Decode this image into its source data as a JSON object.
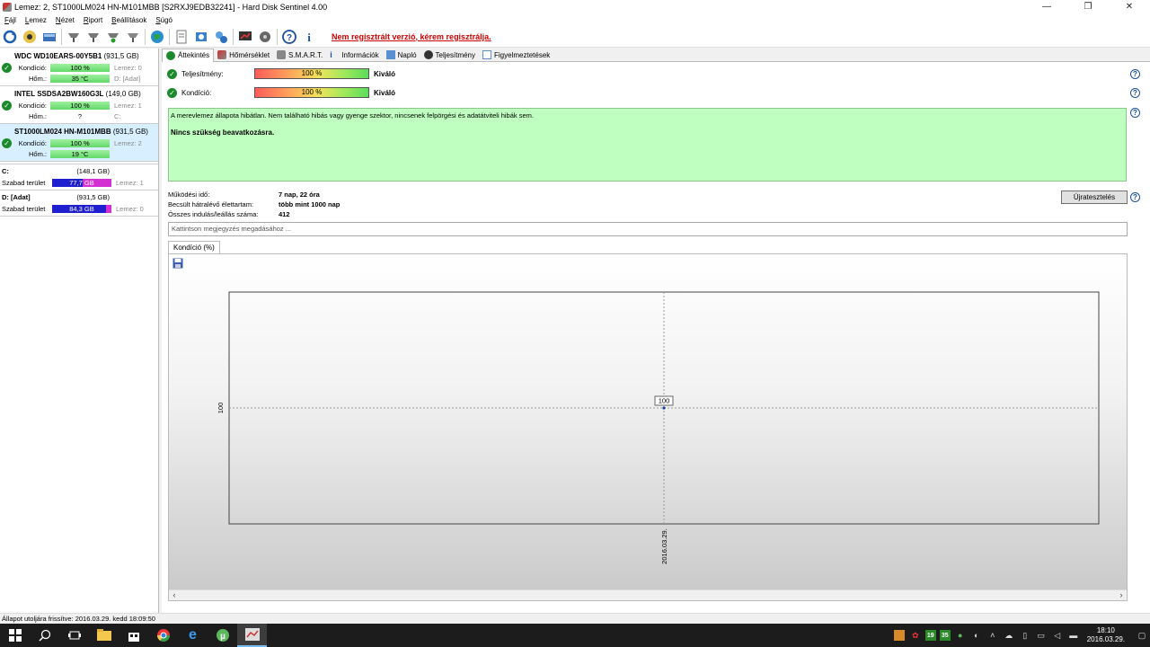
{
  "window": {
    "title": "Lemez: 2, ST1000LM024 HN-M101MBB [S2RXJ9EDB32241]  -  Hard Disk Sentinel 4.00",
    "controls": [
      "—",
      "❐",
      "✕"
    ]
  },
  "menu": [
    "Fájl",
    "Lemez",
    "Nézet",
    "Riport",
    "Beállítások",
    "Súgó"
  ],
  "toolbar": {
    "register_link": "Nem regisztrált verzió, kérem regisztrálja."
  },
  "disks": [
    {
      "name": "WDC WD10EARS-00Y5B1",
      "size": "(931,5 GB)",
      "cond_label": "Kondíció:",
      "cond": "100 %",
      "cond_side": "Lemez: 0",
      "temp_label": "Hőm.:",
      "temp": "35 °C",
      "temp_side": "D: [Adat]",
      "selected": false
    },
    {
      "name": "INTEL SSDSA2BW160G3L",
      "size": "(149,0 GB)",
      "cond_label": "Kondíció:",
      "cond": "100 %",
      "cond_side": "Lemez: 1",
      "temp_label": "Hőm.:",
      "temp": "?",
      "temp_side": "C:",
      "selected": false
    },
    {
      "name": "ST1000LM024 HN-M101MBB",
      "size": "(931,5 GB)",
      "cond_label": "Kondíció:",
      "cond": "100 %",
      "cond_side": "Lemez: 2",
      "temp_label": "Hőm.:",
      "temp": "19 °C",
      "temp_side": "",
      "selected": true
    }
  ],
  "volumes": [
    {
      "name": "C:",
      "size": "(148,1 GB)",
      "free_label": "Szabad terület",
      "free": "77,7 GB",
      "used_fraction": 0.48,
      "side": "Lemez: 1"
    },
    {
      "name": "D: [Adat]",
      "size": "(931,5 GB)",
      "free_label": "Szabad terület",
      "free": "84,3 GB",
      "used_fraction": 0.09,
      "side": "Lemez: 0"
    }
  ],
  "tabs": [
    "Áttekintés",
    "Hőmérséklet",
    "S.M.A.R.T.",
    "Információk",
    "Napló",
    "Teljesítmény",
    "Figyelmeztetések"
  ],
  "overview": {
    "performance_label": "Teljesítmény:",
    "performance_value": "100 %",
    "performance_rating": "Kiváló",
    "condition_label": "Kondíció:",
    "condition_value": "100 %",
    "condition_rating": "Kiváló",
    "status_text": "A merevlemez állapota hibátlan. Nem található hibás vagy gyenge szektor, nincsenek felpörgési és adatátviteli hibák sem.",
    "status_action": "Nincs szükség beavatkozásra.",
    "info": [
      {
        "label": "Működési idő:",
        "value": "7 nap, 22 óra"
      },
      {
        "label": "Becsült hátralévő élettartam:",
        "value": "több mint 1000 nap"
      },
      {
        "label": "Összes indulás/leállás száma:",
        "value": "412"
      }
    ],
    "retest_button": "Újratesztelés",
    "note_placeholder": "Kattintson megjegyzés megadásához ..."
  },
  "chart_tab": "Kondíció  (%)",
  "chart_data": {
    "type": "line",
    "x": [
      "2016.03.29."
    ],
    "series": [
      {
        "values": [
          100
        ]
      }
    ],
    "ylabel_tick": "100",
    "point_label": "100",
    "grid": true
  },
  "statusbar": "Állapot utoljára frissítve: 2016.03.29. kedd 18:09:50",
  "taskbar": {
    "time": "18:10",
    "date": "2016.03.29.",
    "tray_nums": [
      "19",
      "35"
    ]
  }
}
